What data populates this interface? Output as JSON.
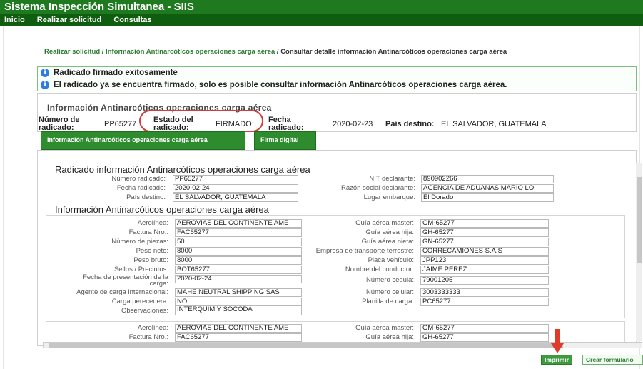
{
  "app": {
    "title": "Sistema Inspección Simultanea - SIIS"
  },
  "nav": {
    "items": [
      "Inicio",
      "Realizar solicitud",
      "Consultas"
    ]
  },
  "breadcrumb": {
    "link": "Realizar solicitud / Información Antinarcóticos operaciones carga aérea",
    "current": "/ Consultar detalle información Antinarcóticos operaciones carga aérea"
  },
  "messages": [
    "Radicado firmado exitosamente",
    "El radicado ya se encuentra firmado, solo es posible consultar información Antinarcóticos operaciones carga aérea."
  ],
  "summary": {
    "title": "Información Antinarcóticos operaciones carga aérea",
    "numero_label_1": "Número de",
    "numero_label_2": "radicado:",
    "numero_value": "PP65277",
    "estado_label_1": "Estado del",
    "estado_label_2": "radicado:",
    "estado_value": "FIRMADO",
    "fecha_label_1": "Fecha",
    "fecha_label_2": "radicado:",
    "fecha_value": "2020-02-23",
    "pais_label": "País destino:",
    "pais_value": "EL SALVADOR, GUATEMALA"
  },
  "tabs": [
    "Información Antinarcóticos operaciones carga aérea",
    "Firma digital"
  ],
  "radicado": {
    "title": "Radicado información Antinarcóticos operaciones carga aérea",
    "left": [
      {
        "label": "Número radicado:",
        "value": "PP65277"
      },
      {
        "label": "Fecha radicado:",
        "value": "2020-02-24"
      },
      {
        "label": "País destino:",
        "value": "EL SALVADOR, GUATEMALA"
      }
    ],
    "right": [
      {
        "label": "NIT declarante:",
        "value": "890902266"
      },
      {
        "label": "Razón social declarante:",
        "value": "AGENCIA DE ADUANAS MARIO LO"
      },
      {
        "label": "Lugar embarque:",
        "value": "El Dorado"
      }
    ]
  },
  "info": {
    "title": "Información Antinarcóticos operaciones carga aérea",
    "left": [
      {
        "label": "Aerolínea:",
        "value": "AEROVIAS DEL CONTINENTE AME"
      },
      {
        "label": "Factura Nro.:",
        "value": "FAC65277"
      },
      {
        "label": "Número de piezas:",
        "value": "50"
      },
      {
        "label": "Peso neto:",
        "value": "8000"
      },
      {
        "label": "Peso bruto:",
        "value": "8000"
      },
      {
        "label": "Sellos / Precintos:",
        "value": "BOT65277"
      },
      {
        "label": "Fecha de presentación de la",
        "label2": "carga:",
        "value": "2020-02-24"
      },
      {
        "label": "Agente de carga internacional:",
        "value": "MAHE NEUTRAL SHIPPING SAS"
      },
      {
        "label": "Carga perecedera:",
        "value": "NO"
      },
      {
        "label": "Observaciones:",
        "value": "INTERQUIM Y SOCODA"
      }
    ],
    "right": [
      {
        "label": "Guía aérea master:",
        "value": "GM-65277"
      },
      {
        "label": "Guía aérea hija:",
        "value": "GH-65277"
      },
      {
        "label": "Guía aérea nieta:",
        "value": "GN-65277"
      },
      {
        "label": "Empresa de transporte terrestre:",
        "value": "CORRECAMIONES S.A.S"
      },
      {
        "label": "Placa vehículo:",
        "value": "JPP123"
      },
      {
        "label": "Nombre del conductor:",
        "value": "JAIME PEREZ"
      },
      {
        "label": "Número cédula:",
        "value": "79001205"
      },
      {
        "label": "Número celular:",
        "value": "3003333333"
      },
      {
        "label": "Planilla de carga:",
        "value": "PC65277"
      }
    ],
    "second_left": [
      {
        "label": "Aerolínea:",
        "value": "AEROVIAS DEL CONTINENTE AME"
      },
      {
        "label": "Factura Nro.:",
        "value": "FAC65277"
      }
    ],
    "second_right": [
      {
        "label": "Guía aérea master:",
        "value": "GM-65277"
      },
      {
        "label": "Guía aérea hija:",
        "value": "GH-65277"
      }
    ]
  },
  "actions": {
    "imprimir": "Imprimir",
    "crear": "Crear formulario"
  },
  "colors": {
    "header_green": "#1f7a1f",
    "nav_green": "#0f5e0f",
    "accent_green": "#2e8b2e",
    "highlight_red": "#d63a3a"
  }
}
